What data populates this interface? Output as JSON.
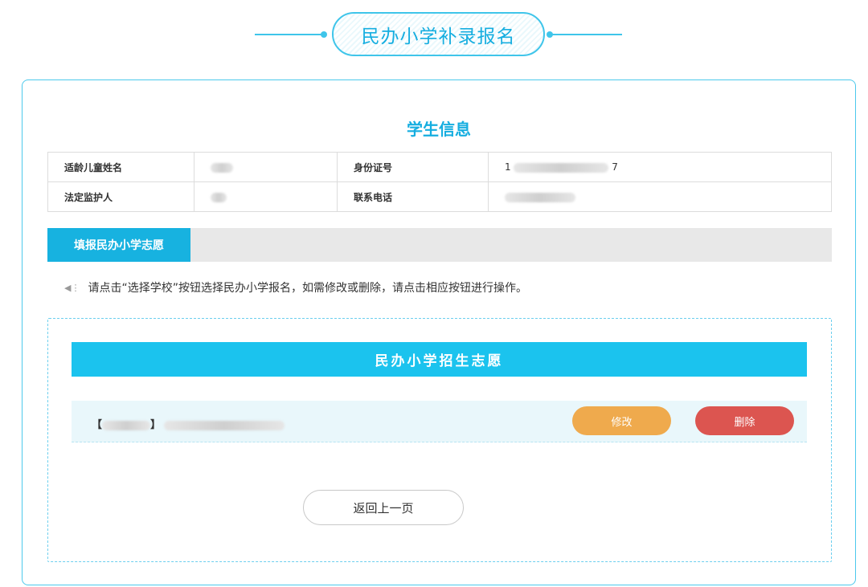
{
  "header": {
    "title": "民办小学补录报名"
  },
  "student_info": {
    "section_title": "学生信息",
    "rows": [
      {
        "label1": "适龄儿童姓名",
        "value1": "[redacted]",
        "label2": "身份证号",
        "value2": "1[redacted]7"
      },
      {
        "label1": "法定监护人",
        "value1": "[redacted]",
        "label2": "联系电话",
        "value2": "[redacted]"
      }
    ]
  },
  "tabs": {
    "active_label": "填报民办小学志愿"
  },
  "tip": {
    "icon": "speaker-icon",
    "text": "请点击“选择学校”按钮选择民办小学报名，如需修改或删除，请点击相应按钮进行操作。"
  },
  "application": {
    "banner_title": "民办小学招生志愿",
    "entry": {
      "school_name": "【[redacted]】[redacted]"
    },
    "edit_label": "修改",
    "delete_label": "删除",
    "back_label": "返回上一页"
  },
  "colors": {
    "accent": "#17b2e0",
    "edit": "#efaa4d",
    "delete": "#dc5550"
  }
}
